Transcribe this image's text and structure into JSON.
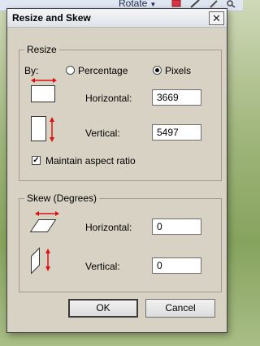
{
  "toolbar": {
    "rotate_label": "Rotate"
  },
  "dialog": {
    "title": "Resize and Skew",
    "close_glyph": "✕",
    "resize": {
      "legend": "Resize",
      "by_label": "By:",
      "percentage_label": "Percentage",
      "pixels_label": "Pixels",
      "selected": "Pixels",
      "horizontal_label": "Horizontal:",
      "horizontal_value": "3669",
      "vertical_label": "Vertical:",
      "vertical_value": "5497",
      "maintain_label": "Maintain aspect ratio",
      "maintain_checked": true,
      "check_glyph": "✓"
    },
    "skew": {
      "legend": "Skew (Degrees)",
      "horizontal_label": "Horizontal:",
      "horizontal_value": "0",
      "vertical_label": "Vertical:",
      "vertical_value": "0"
    },
    "ok_label": "OK",
    "cancel_label": "Cancel"
  },
  "colors": {
    "arrow_red": "#d11",
    "dialog_bg": "#d8d2c4"
  }
}
